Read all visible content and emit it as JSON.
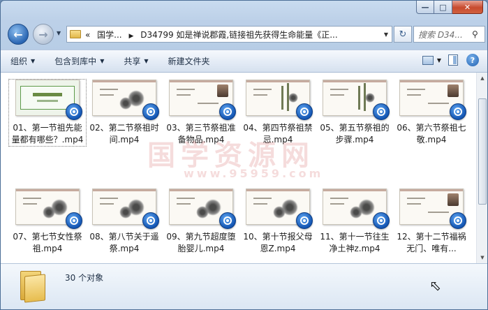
{
  "window": {
    "caption_buttons": {
      "minimize": "—",
      "maximize": "□",
      "close": "✕"
    }
  },
  "nav": {
    "address_parts": [
      "«",
      "国学...",
      "D34799 如是禅说郡霞,链接祖先获得生命能量《正..."
    ],
    "search_placeholder": "搜索 D34...",
    "icons": {
      "back": "back-arrow-icon",
      "forward": "forward-arrow-icon",
      "refresh": "refresh-icon",
      "search": "search-icon"
    }
  },
  "toolbar": {
    "organize": "组织",
    "include_in_library": "包含到库中",
    "share": "共享",
    "new_folder": "新建文件夹"
  },
  "files": [
    {
      "label": "01、第一节祖先能量都有哪些？.mp4",
      "thumb": "green"
    },
    {
      "label": "02、第二节祭祖时间.mp4",
      "thumb": "ink"
    },
    {
      "label": "03、第三节祭祖准备物品.mp4",
      "thumb": "photo"
    },
    {
      "label": "04、第四节祭祖禁忌.mp4",
      "thumb": "bamboo"
    },
    {
      "label": "05、第五节祭祖的步骤.mp4",
      "thumb": "bamboo"
    },
    {
      "label": "06、第六节祭祖七敬.mp4",
      "thumb": "photo"
    },
    {
      "label": "07、第七节女性祭祖.mp4",
      "thumb": "ink"
    },
    {
      "label": "08、第八节关于遥祭.mp4",
      "thumb": "ink"
    },
    {
      "label": "09、第九节超度堕胎婴儿.mp4",
      "thumb": "ink"
    },
    {
      "label": "10、第十节报父母恩Z.mp4",
      "thumb": "ink"
    },
    {
      "label": "11、第十一节往生净土神z.mp4",
      "thumb": "ink"
    },
    {
      "label": "12、第十二节福祸无门、唯有...",
      "thumb": "photo"
    }
  ],
  "watermark": {
    "main": "国学资源网",
    "url": "www.95959.com"
  },
  "details": {
    "count": "30 个对象"
  }
}
